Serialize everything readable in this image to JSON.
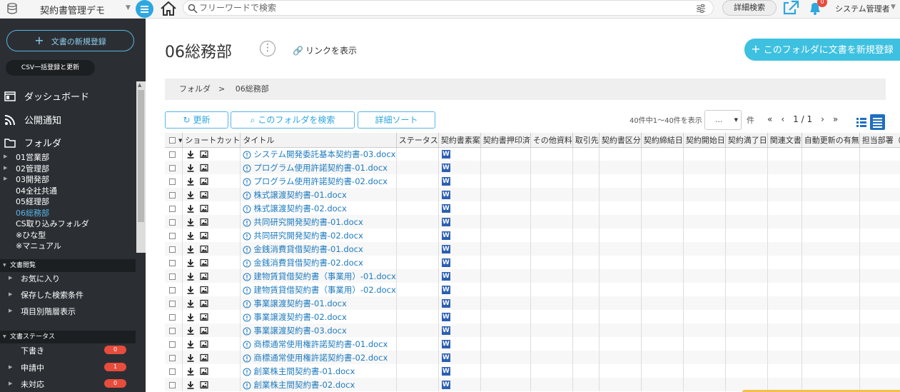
{
  "app": {
    "name": "契約書管理デモ"
  },
  "topbar": {
    "search_placeholder": "フリーワードで検索",
    "advanced_search": "詳細検索",
    "notification_count": "0",
    "user_name": "システム管理者"
  },
  "sidebar": {
    "new_document": "文書の新規登録",
    "csv_import": "CSV一括登録と更新",
    "dashboard": "ダッシュボード",
    "public_notice": "公開通知",
    "folder": "フォルダ",
    "folders": [
      {
        "label": "01営業部",
        "expandable": true
      },
      {
        "label": "02管理部",
        "expandable": true
      },
      {
        "label": "03開発部",
        "expandable": true
      },
      {
        "label": "04全社共通",
        "expandable": false
      },
      {
        "label": "05経理部",
        "expandable": false
      },
      {
        "label": "06総務部",
        "expandable": false,
        "active": true
      },
      {
        "label": "CS取り込みフォルダ",
        "expandable": false
      },
      {
        "label": "※ひな型",
        "expandable": false
      },
      {
        "label": "※マニュアル",
        "expandable": false
      }
    ],
    "browse_section": "文書閲覧",
    "browse_items": [
      "お気に入り",
      "保存した検索条件",
      "項目別階層表示"
    ],
    "status_section": "文書ステータス",
    "status_items": [
      {
        "label": "下書き",
        "count": "0",
        "expandable": false
      },
      {
        "label": "申請中",
        "count": "1",
        "expandable": true
      },
      {
        "label": "未対応",
        "count": "0",
        "expandable": true
      }
    ]
  },
  "main": {
    "title": "06総務部",
    "show_link": "リンクを表示",
    "new_in_folder": "このフォルダに文書を新規登録",
    "breadcrumb": "フォルダ　>　 06総務部",
    "refresh": "更新",
    "search_folder": "このフォルダを検索",
    "detail_sort": "詳細ソート",
    "count_text": "40件中1〜40件を表示",
    "per_page": "...",
    "ken": "件",
    "pager": "«　‹　1 / 1　›　»"
  },
  "table": {
    "columns": [
      "",
      "ショートカット",
      "タイトル",
      "ステータス",
      "契約書素案",
      "契約書押印済",
      "その他資料",
      "取引先",
      "契約書区分",
      "契約締結日",
      "契約開始日",
      "契約満了日",
      "関連文書",
      "自動更新の有無",
      "担当部署（ベ"
    ],
    "rows": [
      "システム開発委託基本契約書-03.docx",
      "プログラム使用許諾契約書-01.docx",
      "プログラム使用許諾契約書-02.docx",
      "株式譲渡契約書-01.docx",
      "株式譲渡契約書-02.docx",
      "共同研究開発契約書-01.docx",
      "共同研究開発契約書-02.docx",
      "金銭消費貸借契約書-01.docx",
      "金銭消費貸借契約書-02.docx",
      "建物賃貸借契約書（事業用）-01.docx",
      "建物賃貸借契約書（事業用）-02.docx",
      "事業譲渡契約書-01.docx",
      "事業譲渡契約書-02.docx",
      "事業譲渡契約書-03.docx",
      "商標通常使用権許諾契約書-01.docx",
      "商標通常使用権許諾契約書-02.docx",
      "創業株主間契約書-01.docx",
      "創業株主間契約書-02.docx"
    ],
    "word_icon_label": "W"
  },
  "colors": {
    "accent": "#2ea7e0",
    "sidebar": "#2b2f33",
    "badge": "#e74c3c",
    "link": "#1f7bbf"
  }
}
